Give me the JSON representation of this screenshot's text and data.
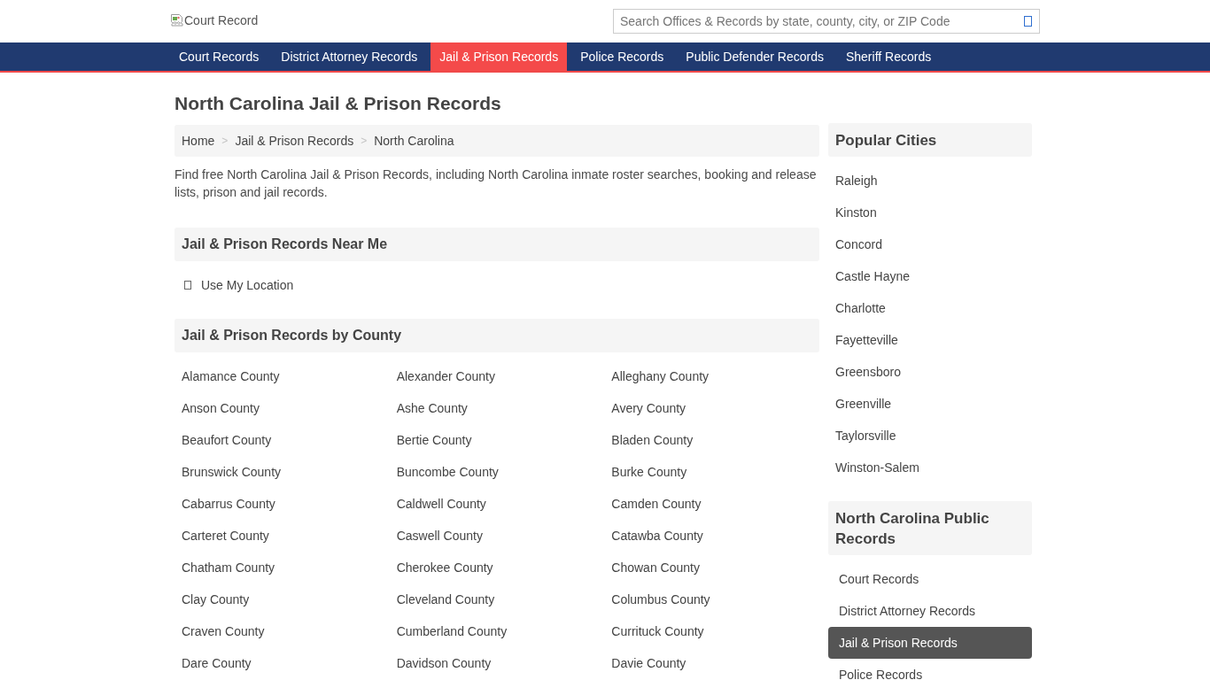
{
  "header": {
    "logo_alt": "Court Record",
    "search": {
      "placeholder": "Search Offices & Records by state, county, city, or ZIP Code"
    }
  },
  "nav": [
    {
      "label": "Court Records",
      "selected": false
    },
    {
      "label": "District Attorney Records",
      "selected": false
    },
    {
      "label": "Jail & Prison Records",
      "selected": true
    },
    {
      "label": "Police Records",
      "selected": false
    },
    {
      "label": "Public Defender Records",
      "selected": false
    },
    {
      "label": "Sheriff Records",
      "selected": false
    }
  ],
  "page_title": "North Carolina Jail & Prison Records",
  "breadcrumb": {
    "separator": ">",
    "items": [
      "Home",
      "Jail & Prison Records",
      "North Carolina"
    ]
  },
  "intro": "Find free North Carolina Jail & Prison Records, including North Carolina inmate roster searches, booking and release lists, prison and jail records.",
  "near_me": {
    "heading": "Jail & Prison Records Near Me",
    "link": "Use My Location"
  },
  "by_county": {
    "heading": "Jail & Prison Records by County",
    "counties": [
      "Alamance County",
      "Alexander County",
      "Alleghany County",
      "Anson County",
      "Ashe County",
      "Avery County",
      "Beaufort County",
      "Bertie County",
      "Bladen County",
      "Brunswick County",
      "Buncombe County",
      "Burke County",
      "Cabarrus County",
      "Caldwell County",
      "Camden County",
      "Carteret County",
      "Caswell County",
      "Catawba County",
      "Chatham County",
      "Cherokee County",
      "Chowan County",
      "Clay County",
      "Cleveland County",
      "Columbus County",
      "Craven County",
      "Cumberland County",
      "Currituck County",
      "Dare County",
      "Davidson County",
      "Davie County"
    ]
  },
  "sidebar": {
    "popular_cities": {
      "heading": "Popular Cities",
      "cities": [
        "Raleigh",
        "Kinston",
        "Concord",
        "Castle Hayne",
        "Charlotte",
        "Fayetteville",
        "Greensboro",
        "Greenville",
        "Taylorsville",
        "Winston-Salem"
      ]
    },
    "public_records": {
      "heading": "North Carolina Public Records",
      "items": [
        {
          "label": "Court Records",
          "selected": false
        },
        {
          "label": "District Attorney Records",
          "selected": false
        },
        {
          "label": "Jail & Prison Records",
          "selected": true
        },
        {
          "label": "Police Records",
          "selected": false
        }
      ]
    }
  }
}
